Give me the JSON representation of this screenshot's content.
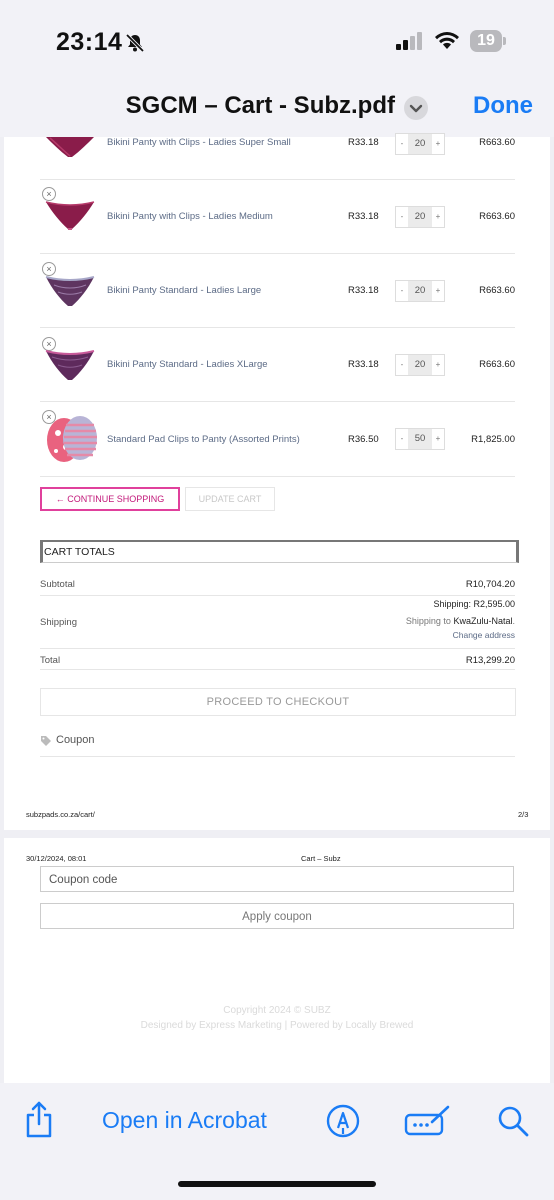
{
  "status_bar": {
    "time": "23:14",
    "battery": "19",
    "icons": [
      "bell-slash-icon",
      "cellular-signal-icon",
      "wifi-icon",
      "battery-icon"
    ]
  },
  "nav": {
    "title": "SGCM – Cart - Subz.pdf",
    "done_label": "Done",
    "title_menu_icon": "chevron-down-icon"
  },
  "cart": {
    "items": [
      {
        "name": "Bikini Panty with Clips - Ladies Super Small",
        "price": "R33.18",
        "qty": "20",
        "subtotal": "R663.60"
      },
      {
        "name": "Bikini Panty with Clips - Ladies Medium",
        "price": "R33.18",
        "qty": "20",
        "subtotal": "R663.60"
      },
      {
        "name": "Bikini Panty Standard - Ladies Large",
        "price": "R33.18",
        "qty": "20",
        "subtotal": "R663.60"
      },
      {
        "name": "Bikini Panty Standard - Ladies XLarge",
        "price": "R33.18",
        "qty": "20",
        "subtotal": "R663.60"
      },
      {
        "name": "Standard Pad Clips to Panty (Assorted Prints)",
        "price": "R36.50",
        "qty": "50",
        "subtotal": "R1,825.00"
      }
    ],
    "remove_glyph": "×",
    "minus": "-",
    "plus": "+",
    "continue_label": "← CONTINUE SHOPPING",
    "update_label": "UPDATE CART"
  },
  "totals": {
    "heading": "CART TOTALS",
    "subtotal_label": "Subtotal",
    "subtotal_value": "R10,704.20",
    "shipping_label": "Shipping",
    "shipping_value": "Shipping: R2,595.00",
    "shipping_to_prefix": "Shipping to ",
    "shipping_to_region": "KwaZulu-Natal",
    "shipping_to_suffix": ".",
    "change_address": "Change address",
    "total_label": "Total",
    "total_value": "R13,299.20",
    "checkout_label": "PROCEED TO CHECKOUT",
    "coupon_label": "Coupon"
  },
  "page1_footer": {
    "url": "subzpads.co.za/cart/",
    "page": "2/3"
  },
  "page2_header": {
    "datetime": "30/12/2024, 08:01",
    "title": "Cart – Subz"
  },
  "coupon_form": {
    "placeholder": "Coupon code",
    "apply_label": "Apply coupon"
  },
  "site_footer": {
    "copyright_prefix": "Copyright 2024 © ",
    "brand": "SUBZ",
    "credits": "Designed by Express Marketing | Powered by Locally Brewed"
  },
  "toolbar": {
    "open_in_acrobat": "Open in Acrobat",
    "icons": [
      "share-icon",
      "markup-pen-icon",
      "signature-icon",
      "search-icon"
    ]
  },
  "colors": {
    "accent_blue": "#1a7cf5",
    "continue_pink": "#e0409c",
    "panty_maroon": "#8a1c4a",
    "panty_purple": "#5e3560"
  }
}
